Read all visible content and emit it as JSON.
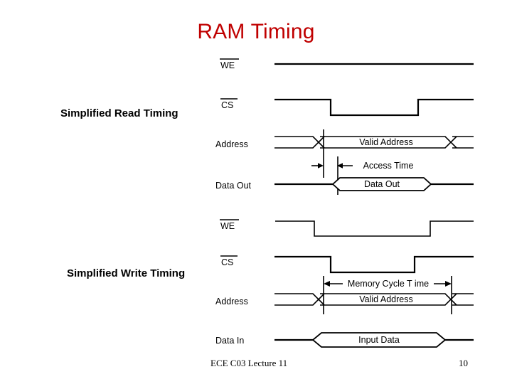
{
  "slide": {
    "title": "RAM Timing",
    "title_color": "#C00000",
    "background_color": "#FFFFFF"
  },
  "sections": {
    "read": {
      "label": "Simplified Read Timing"
    },
    "write": {
      "label": "Simplified Write Timing"
    }
  },
  "diagram": {
    "line_color": "#000000",
    "read": {
      "signals": [
        {
          "name": "WE",
          "label": "WE",
          "overbar": true,
          "type": "level-high"
        },
        {
          "name": "CS",
          "label": "CS",
          "overbar": true,
          "type": "pulse-low"
        },
        {
          "name": "Address",
          "label": "Address",
          "overbar": false,
          "type": "bus",
          "bus_text": "Valid Address"
        },
        {
          "name": "DataOut",
          "label": "Data Out",
          "overbar": false,
          "type": "data",
          "bus_text": "Data Out"
        }
      ],
      "annotation": "Access Time"
    },
    "write": {
      "signals": [
        {
          "name": "WE",
          "label": "WE",
          "overbar": true,
          "type": "pulse-low"
        },
        {
          "name": "CS",
          "label": "CS",
          "overbar": true,
          "type": "pulse-low"
        },
        {
          "name": "Address",
          "label": "Address",
          "overbar": false,
          "type": "bus",
          "bus_text": "Valid Address"
        },
        {
          "name": "DataIn",
          "label": "Data In",
          "overbar": false,
          "type": "data",
          "bus_text": "Input Data"
        }
      ],
      "annotation": "Memory Cycle T ime"
    }
  },
  "footer": {
    "center": "ECE C03 Lecture 11",
    "page_number": "10"
  }
}
